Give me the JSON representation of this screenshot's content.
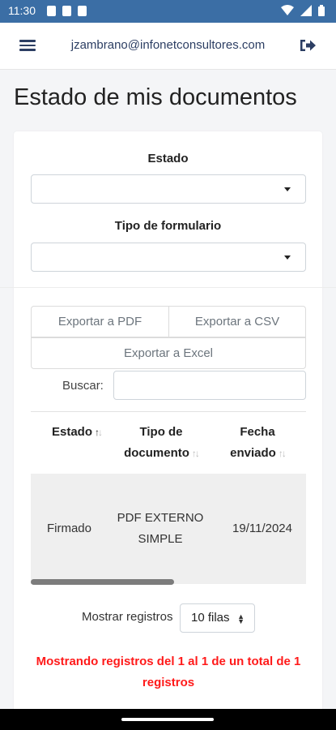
{
  "status_bar": {
    "time": "11:30",
    "left_icons": [
      "shield-icon",
      "sim-icon",
      "media-icon"
    ],
    "right_icons": [
      "wifi-icon",
      "signal-icon",
      "battery-icon"
    ],
    "background": "#3b6ea5"
  },
  "header": {
    "user_email": "jzambrano@infonetconsultores.com",
    "menu_icon": "hamburger-menu-icon",
    "logout_icon": "logout-icon",
    "accent": "#2c3e63"
  },
  "page": {
    "title": "Estado de mis documentos"
  },
  "filters": {
    "estado_label": "Estado",
    "estado_value": "",
    "tipo_label": "Tipo de formulario",
    "tipo_value": ""
  },
  "export": {
    "pdf_label": "Exportar a PDF",
    "csv_label": "Exportar a CSV",
    "excel_label": "Exportar a Excel"
  },
  "search": {
    "label": "Buscar:",
    "value": ""
  },
  "table": {
    "columns": [
      {
        "line1": "",
        "line2": "Estado"
      },
      {
        "line1": "Tipo de",
        "line2": "documento"
      },
      {
        "line1": "Fecha",
        "line2": "enviado"
      }
    ],
    "sort_up": "↑",
    "sort_down": "↓",
    "rows": [
      {
        "estado": "Firmado",
        "tipo_line1": "PDF EXTERNO",
        "tipo_line2": "SIMPLE",
        "fecha": "19/11/2024"
      }
    ],
    "row_background": "#efefef"
  },
  "pagination": {
    "show_label": "Mostrar registros",
    "rows_option": "10 filas",
    "info_text": "Mostrando registros del 1 al 1 de un total de 1 registros",
    "info_color": "#ff1a1a"
  }
}
